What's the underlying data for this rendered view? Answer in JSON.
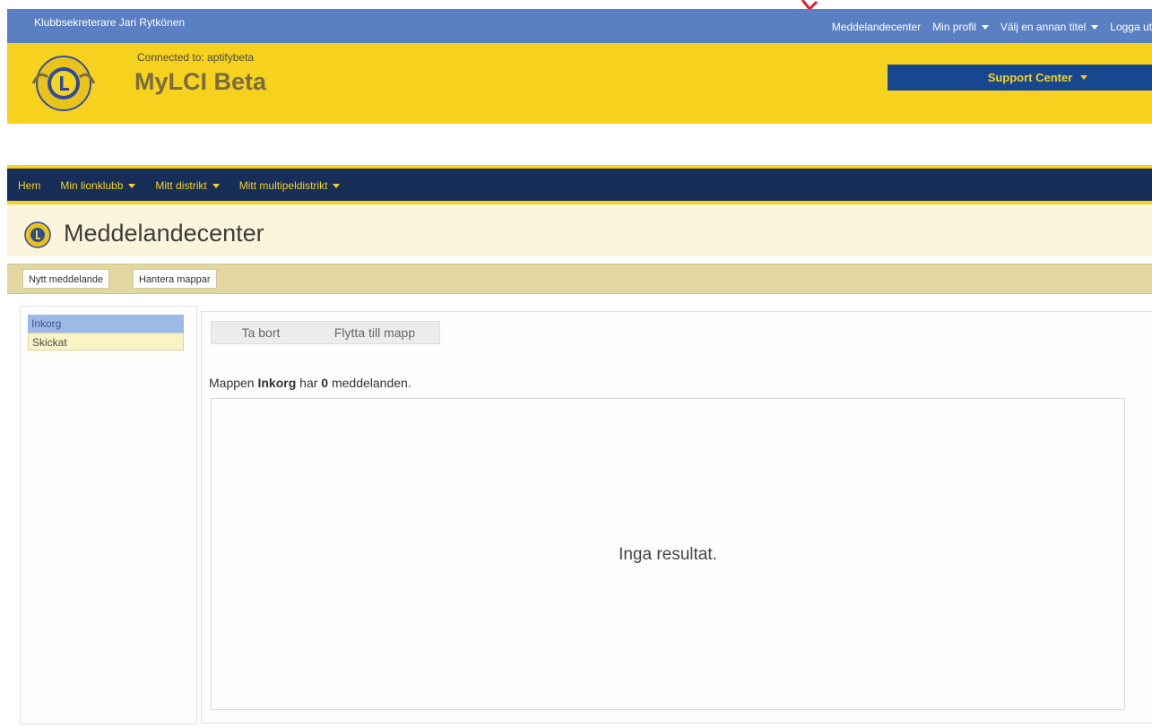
{
  "topbar": {
    "user": "Klubbsekreterare Jari Rytkönen",
    "links": [
      "Meddelandecenter",
      "Min profil",
      "Välj en annan titel",
      "Logga ut"
    ]
  },
  "header": {
    "connected": "Connected to: aptifybeta",
    "brand": "MyLCI Beta",
    "support": "Support Center"
  },
  "nav": [
    "Hem",
    "Min lionklubb",
    "Mitt distrikt",
    "Mitt multipeldistrikt"
  ],
  "page": {
    "title": "Meddelandecenter"
  },
  "toolbar": {
    "new_message": "Nytt meddelande",
    "manage_folders": "Hantera mappar"
  },
  "folders": [
    "Inkorg",
    "Skickat"
  ],
  "actions": {
    "delete": "Ta bort",
    "move": "Flytta till mapp"
  },
  "info": {
    "prefix": "Mappen",
    "folder": "Inkorg",
    "middle": "har",
    "count": "0",
    "suffix": "meddelanden."
  },
  "results": {
    "empty": "Inga resultat."
  },
  "colors": {
    "blue_bar": "#5a7fc2",
    "yellow": "#f6d11e",
    "navy": "#172e58",
    "support_blue": "#17488f"
  }
}
